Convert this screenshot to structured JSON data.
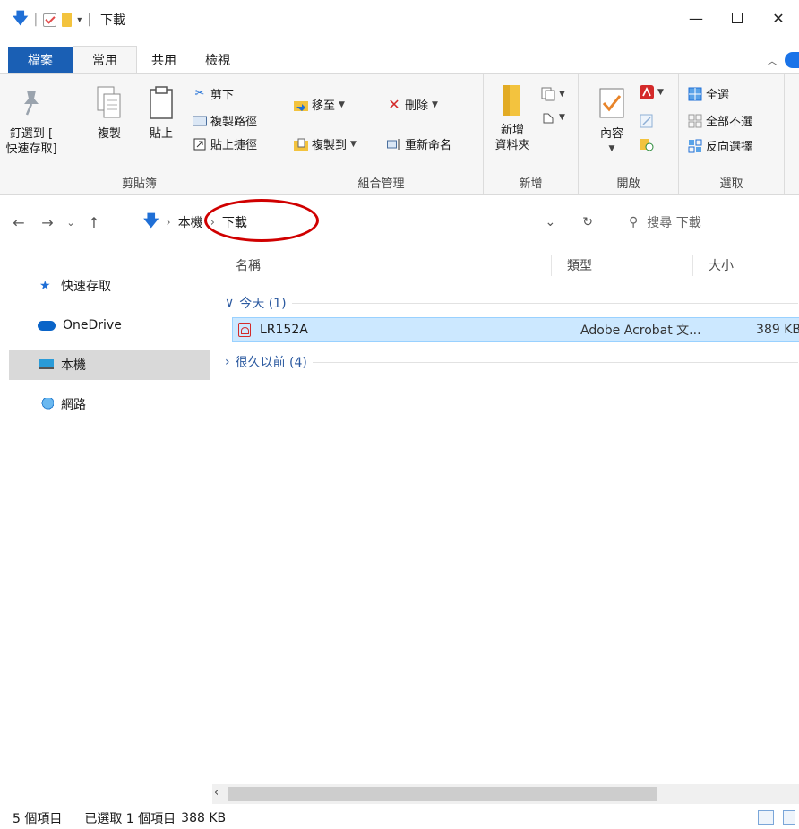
{
  "title_bar": {
    "title": "下載",
    "controls": {
      "minimize": "—",
      "close": "✕"
    }
  },
  "tabs": [
    "檔案",
    "常用",
    "共用",
    "檢視"
  ],
  "ribbon": {
    "clipboard": {
      "label": "剪貼簿",
      "pin": [
        "釘選到 [",
        "快速存取]"
      ],
      "copy": "複製",
      "paste": "貼上",
      "cut": "剪下",
      "copy_path": "複製路徑",
      "paste_shortcut": "貼上捷徑"
    },
    "organize": {
      "label": "組合管理",
      "move_to": "移至",
      "copy_to": "複製到",
      "delete": "刪除",
      "rename": "重新命名"
    },
    "new": {
      "label": "新增",
      "new_folder": [
        "新增",
        "資料夾"
      ]
    },
    "open": {
      "label": "開啟",
      "properties": "內容"
    },
    "select": {
      "label": "選取",
      "select_all": "全選",
      "select_none": "全部不選",
      "invert": "反向選擇"
    }
  },
  "address": {
    "crumbs": [
      "本機",
      "下載"
    ],
    "search_placeholder": "搜尋 下載"
  },
  "nav_pane": {
    "items": [
      {
        "label": "快速存取",
        "icon": "star-icon"
      },
      {
        "label": "OneDrive",
        "icon": "cloud-icon"
      },
      {
        "label": "本機",
        "icon": "computer-icon",
        "selected": true
      },
      {
        "label": "網路",
        "icon": "network-icon"
      }
    ]
  },
  "columns": {
    "name": "名稱",
    "type": "類型",
    "size": "大小"
  },
  "groups": [
    {
      "label": "今天 (1)",
      "expanded": true
    },
    {
      "label": "很久以前 (4)",
      "expanded": false
    }
  ],
  "files": [
    {
      "name": "LR152A",
      "type": "Adobe Acrobat 文...",
      "size": "389 KB",
      "selected": true
    }
  ],
  "status": {
    "items": "5 個項目",
    "selected": "已選取 1 個項目",
    "selected_size": "388 KB"
  },
  "colors": {
    "accent": "#1a5fb4",
    "selection": "#cce8ff",
    "annotation": "#d00000"
  }
}
